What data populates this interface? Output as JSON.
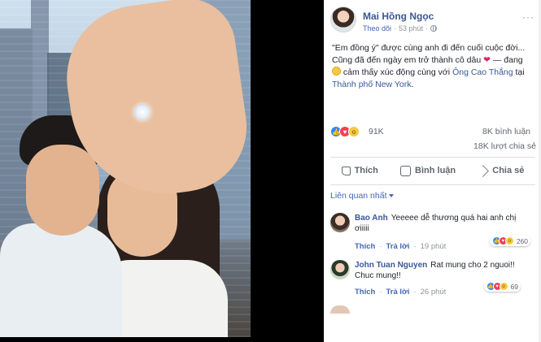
{
  "post": {
    "author": "Mai Hồng Ngọc",
    "follow": "Theo dõi",
    "dot": "·",
    "time": "53 phút",
    "more": "···",
    "text_line1": "\"Em đồng ý\" được cùng anh đi đến cuối cuộc đời...",
    "text_line2_pre": "Cũng đã đến ngày em trở thành cô dâu",
    "heart": "❤",
    "text_line2_post": "— đang",
    "text_line3_post": "cảm thấy xúc động cùng với",
    "tag_person": "Ông Cao Thắng",
    "text_line4_pre": "tại",
    "tag_place": "Thành phố New York",
    "period": "."
  },
  "stats": {
    "reactions": "91K",
    "comments": "8K bình luận",
    "shares": "18K lượt chia sẻ"
  },
  "actions": {
    "like": "Thích",
    "comment": "Bình luận",
    "share": "Chia sẻ"
  },
  "filter": {
    "label": "Liên quan nhất"
  },
  "comments": [
    {
      "name": "Bao Anh",
      "text": "Yeeeee dễ thương quá hai anh chị ơiiiii",
      "like": "Thích",
      "reply": "Trả lời",
      "time": "19 phút",
      "reactions": "260"
    },
    {
      "name": "John Tuan Nguyen",
      "text": "Rat mung cho 2 nguoi!! Chuc mung!!",
      "like": "Thích",
      "reply": "Trả lời",
      "time": "26 phút",
      "reactions": "69"
    }
  ],
  "colors": {
    "link": "#385898",
    "accent": "#4267b2",
    "muted": "#90949c",
    "heart": "#e0245e"
  },
  "icons": [
    "globe-icon",
    "more-icon",
    "like-icon",
    "love-icon",
    "wow-icon",
    "comment-icon",
    "share-icon",
    "chevron-down-icon"
  ]
}
